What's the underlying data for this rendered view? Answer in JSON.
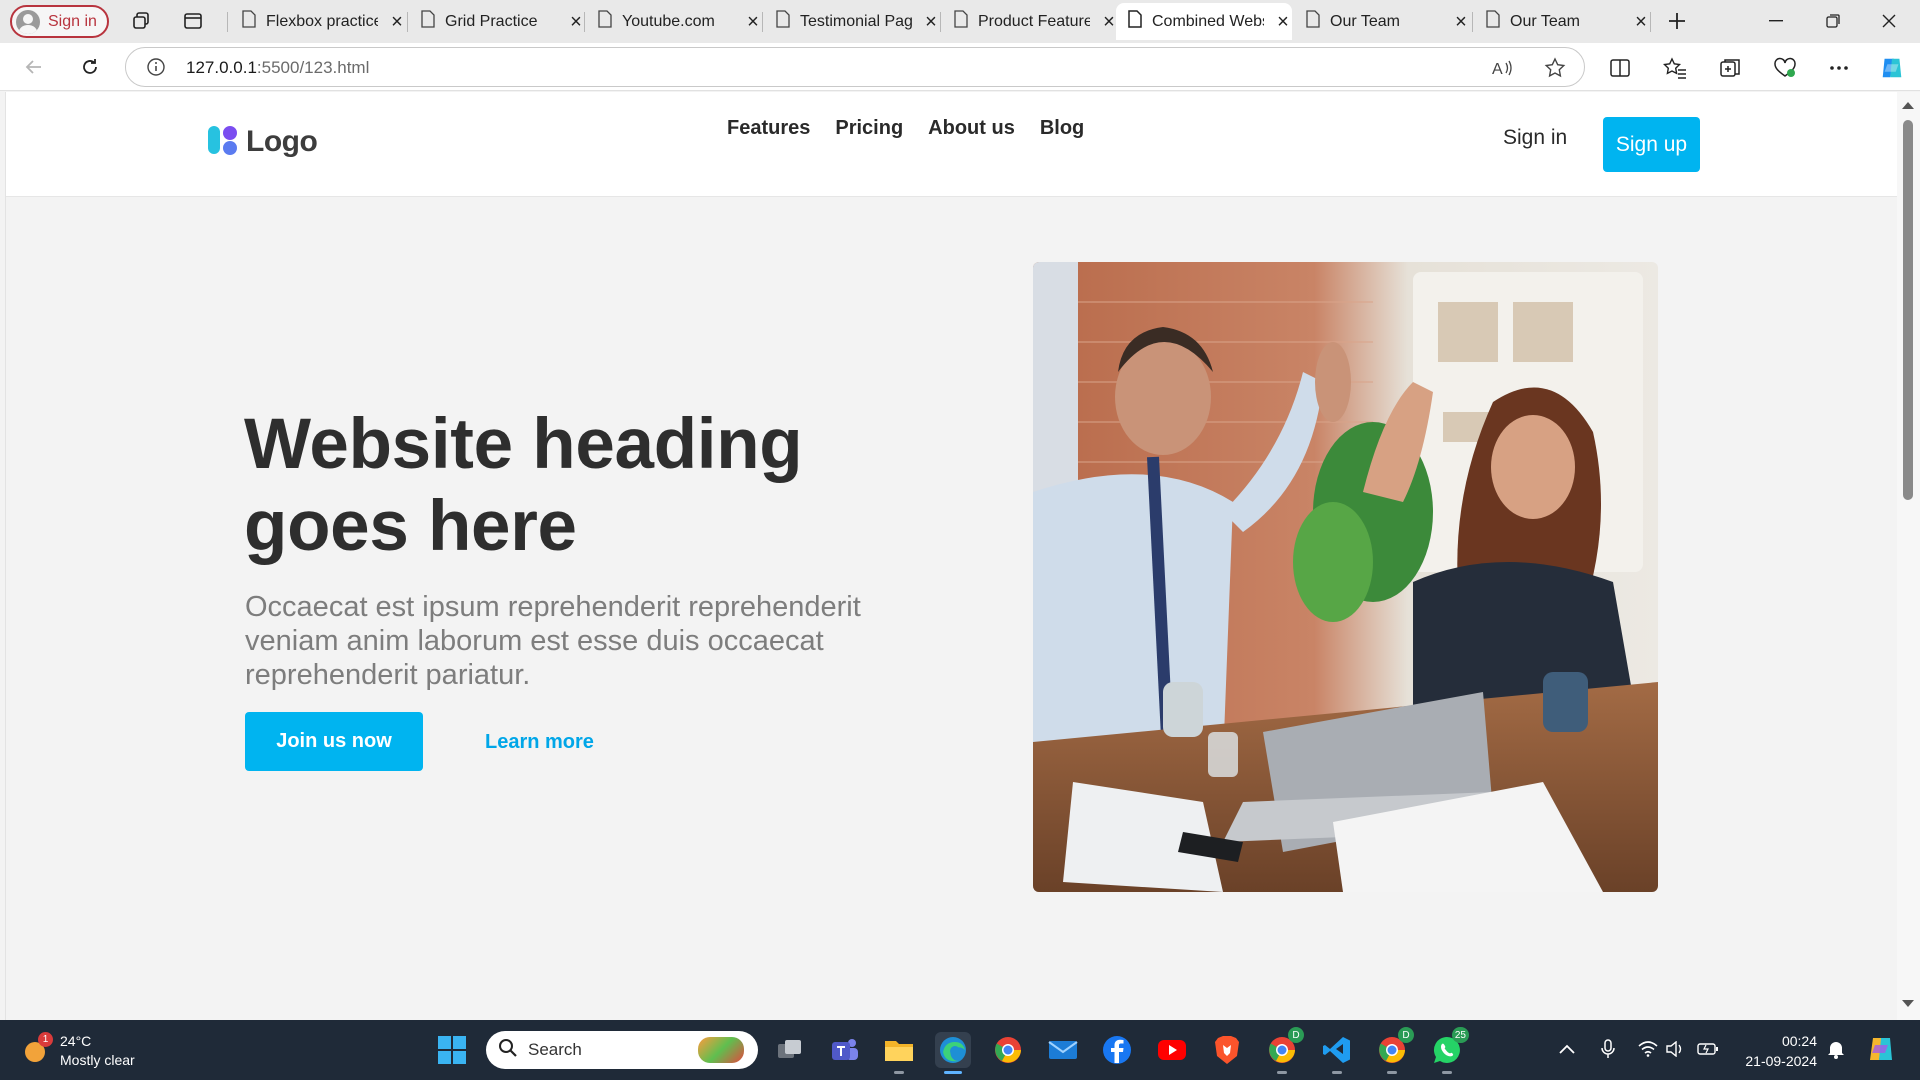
{
  "browser": {
    "profile_label": "Sign in",
    "tabs": [
      {
        "title": "Flexbox practice"
      },
      {
        "title": "Grid Practice"
      },
      {
        "title": "Youtube.com"
      },
      {
        "title": "Testimonial Page"
      },
      {
        "title": "Product Features"
      },
      {
        "title": "Combined Website"
      },
      {
        "title": "Our Team"
      },
      {
        "title": "Our Team"
      }
    ],
    "active_tab_index": 5,
    "url_host": "127.0.0.1",
    "url_rest": ":5500/123.html"
  },
  "site": {
    "logo_text": "Logo",
    "nav": [
      "Features",
      "Pricing",
      "About us",
      "Blog"
    ],
    "signin_label": "Sign in",
    "signup_label": "Sign up",
    "hero": {
      "heading": "Website heading goes here",
      "subtext": "Occaecat est ipsum reprehenderit reprehenderit veniam anim laborum est esse duis occaecat reprehenderit pariatur.",
      "primary_cta": "Join us now",
      "secondary_cta": "Learn more"
    },
    "colors": {
      "accent": "#00b4f0",
      "heading": "#2e2e2e",
      "subtext": "#7d7d7d"
    }
  },
  "taskbar": {
    "weather_temp": "24°C",
    "weather_desc": "Mostly clear",
    "weather_badge": "1",
    "search_placeholder": "Search",
    "chrome_badge_1": "D",
    "chrome_badge_2": "D",
    "whatsapp_badge": "25",
    "time": "00:24",
    "date": "21-09-2024"
  }
}
